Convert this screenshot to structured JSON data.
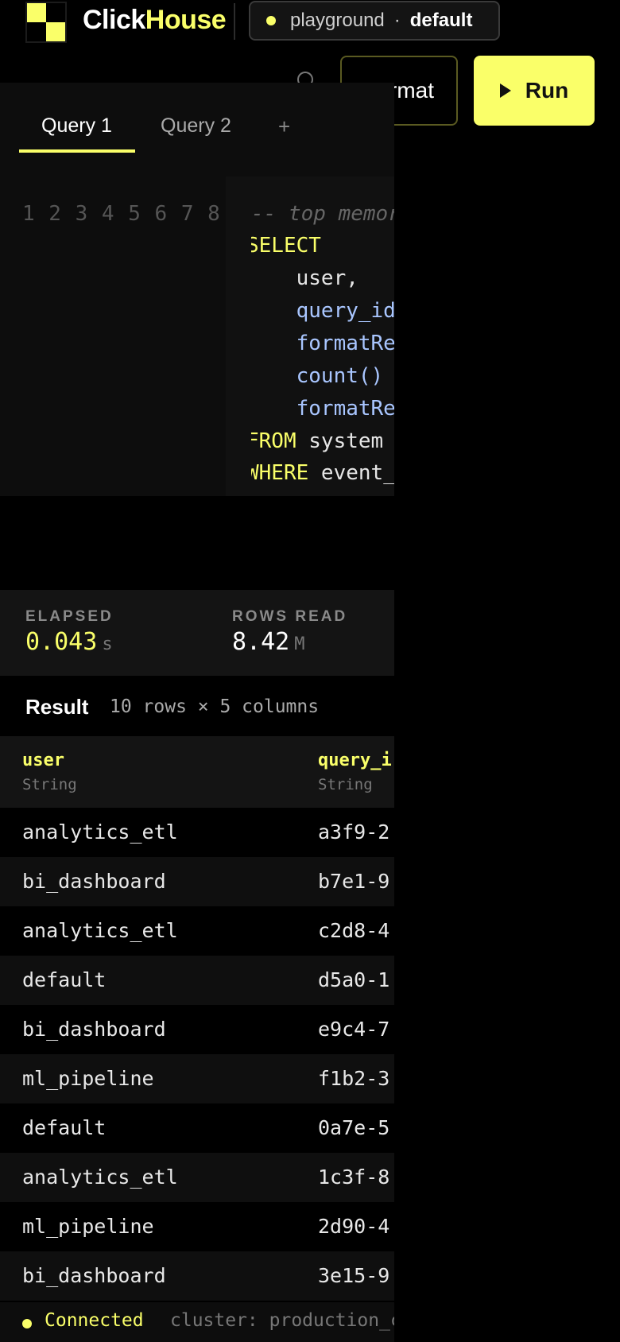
{
  "header": {
    "brand_prefix": "Click",
    "brand_suffix": "House",
    "service": "playground",
    "separator": "·",
    "database": "default",
    "format_label": "rmat",
    "run_label": "Run",
    "accent": "#faff69"
  },
  "tabs": [
    {
      "label": "Query 1"
    },
    {
      "label": "Query 2"
    }
  ],
  "add_tab": "+",
  "editor": {
    "line_numbers": "1 2 3 4 5 6 7 8",
    "lines": [
      "-- top memory",
      "SELECT",
      "    user,",
      "    query_id",
      "    formatRe",
      "    count()",
      "    formatRe",
      [
        "FROM",
        " system"
      ],
      [
        "WHERE",
        " event_"
      ]
    ]
  },
  "stats": {
    "elapsed_label": "ELAPSED",
    "elapsed_value": "0.043",
    "elapsed_unit": "s",
    "rows_label": "ROWS READ",
    "rows_value": "8.42",
    "rows_unit": "M"
  },
  "result": {
    "title": "Result",
    "meta": "10 rows × 5 columns",
    "columns": [
      {
        "name": "user",
        "type": "String"
      },
      {
        "name": "query_i",
        "type": "String"
      }
    ],
    "rows": [
      [
        "analytics_etl",
        "a3f9-2"
      ],
      [
        "bi_dashboard",
        "b7e1-9"
      ],
      [
        "analytics_etl",
        "c2d8-4"
      ],
      [
        "default",
        "d5a0-1"
      ],
      [
        "bi_dashboard",
        "e9c4-7"
      ],
      [
        "ml_pipeline",
        "f1b2-3"
      ],
      [
        "default",
        "0a7e-5"
      ],
      [
        "analytics_etl",
        "1c3f-8"
      ],
      [
        "ml_pipeline",
        "2d90-4"
      ],
      [
        "bi_dashboard",
        "3e15-9"
      ]
    ]
  },
  "status": {
    "connected": "Connected",
    "cluster": "cluster: production_c"
  }
}
